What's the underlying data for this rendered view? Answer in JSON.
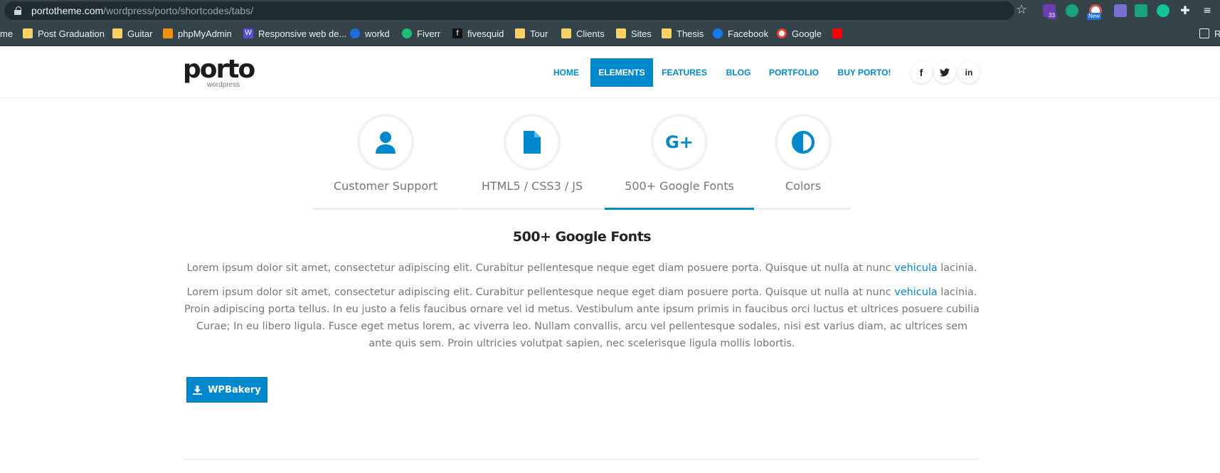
{
  "browser": {
    "url_host": "portotheme.com",
    "url_path": "/wordpress/porto/shortcodes/tabs/",
    "extensions": [
      {
        "name": "extension-33",
        "badge": "33",
        "color": "#6b3fb3"
      },
      {
        "name": "extension-sync",
        "badge": "",
        "color": "#1aa37a"
      },
      {
        "name": "extension-new",
        "badge": "New",
        "color": "#d9534f"
      },
      {
        "name": "extension-tool",
        "badge": "",
        "color": "#7b6fd6"
      },
      {
        "name": "extension-green",
        "badge": "",
        "color": "#1aa37a"
      },
      {
        "name": "grammarly",
        "badge": "",
        "color": "#15c39a"
      }
    ],
    "bookmarks": [
      {
        "label": "me",
        "icon": "folder"
      },
      {
        "label": "Post Graduation",
        "icon": "folder"
      },
      {
        "label": "Guitar",
        "icon": "folder"
      },
      {
        "label": "phpMyAdmin",
        "icon": "phpmyadmin"
      },
      {
        "label": "Responsive web de...",
        "icon": "w"
      },
      {
        "label": "workd",
        "icon": "check"
      },
      {
        "label": "Fiverr",
        "icon": "fiverr"
      },
      {
        "label": "fivesquid",
        "icon": "f"
      },
      {
        "label": "Tour",
        "icon": "folder"
      },
      {
        "label": "Clients",
        "icon": "folder"
      },
      {
        "label": "Sites",
        "icon": "folder"
      },
      {
        "label": "Thesis",
        "icon": "folder"
      },
      {
        "label": "Facebook",
        "icon": "facebook"
      },
      {
        "label": "Google",
        "icon": "google"
      },
      {
        "label": "",
        "icon": "youtube"
      }
    ],
    "reading_list_label": "R"
  },
  "site": {
    "logo_word": "porto",
    "logo_sub": "wordpress",
    "nav": [
      {
        "label": "HOME",
        "active": false
      },
      {
        "label": "ELEMENTS",
        "active": true
      },
      {
        "label": "FEATURES",
        "active": false
      },
      {
        "label": "BLOG",
        "active": false
      },
      {
        "label": "PORTFOLIO",
        "active": false
      },
      {
        "label": "BUY PORTO!",
        "active": false
      }
    ],
    "social": [
      "f",
      "t",
      "in"
    ]
  },
  "tabs": [
    {
      "label": "Customer Support",
      "icon": "user-icon"
    },
    {
      "label": "HTML5 / CSS3 / JS",
      "icon": "file-icon"
    },
    {
      "label": "500+ Google Fonts",
      "icon": "google-plus-icon",
      "icon_text": "G+"
    },
    {
      "label": "Colors",
      "icon": "adjust-icon"
    }
  ],
  "content": {
    "title": "500+ Google Fonts",
    "para1_before": "Lorem ipsum dolor sit amet, consectetur adipiscing elit. Curabitur pellentesque neque eget diam posuere porta. Quisque ut nulla at nunc ",
    "para1_link": "vehicula",
    "para1_after": " lacinia.",
    "para2_before": "Lorem ipsum dolor sit amet, consectetur adipiscing elit. Curabitur pellentesque neque eget diam posuere porta. Quisque ut nulla at nunc ",
    "para2_link": "vehicula",
    "para2_after": " lacinia. Proin adipiscing porta tellus. In eu justo a felis faucibus ornare vel id metus. Vestibulum ante ipsum primis in faucibus orci luctus et ultrices posuere cubilia Curae; In eu libero ligula. Fusce eget metus lorem, ac viverra leo. Nullam convallis, arcu vel pellentesque sodales, nisi est varius diam, ac ultrices sem ante quis sem. Proin ultricies volutpat sapien, nec scelerisque ligula mollis lobortis.",
    "button_label": "WPBakery"
  },
  "colors": {
    "accent": "#0088cc",
    "chrome": "#35434b",
    "text": "#777777"
  }
}
